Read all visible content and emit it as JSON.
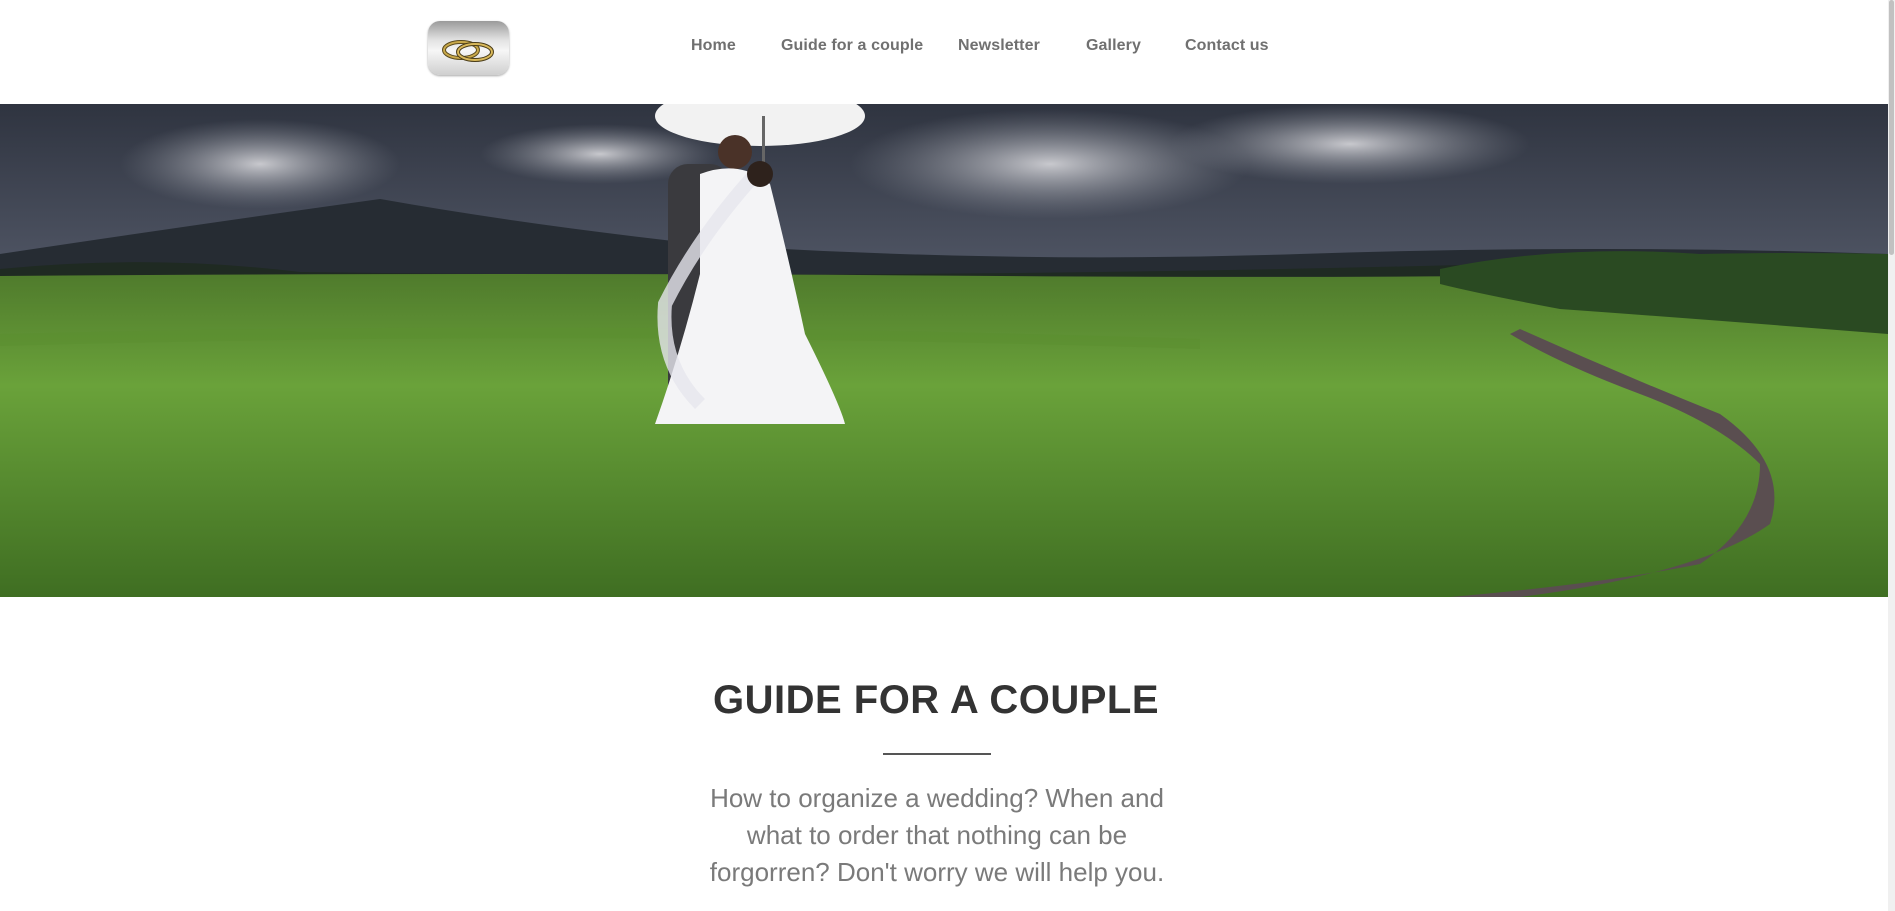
{
  "header": {
    "logo_alt": "Wedding rings logo",
    "nav": [
      {
        "label": "Home"
      },
      {
        "label": "Guide for a couple"
      },
      {
        "label": "Newsletter"
      },
      {
        "label": "Gallery"
      },
      {
        "label": "Contact us"
      }
    ]
  },
  "hero": {
    "image_alt": "Bride and groom under a white umbrella in a green field"
  },
  "section": {
    "title": "GUIDE FOR A COUPLE",
    "lead": "How to organize a wedding? When and what to order that nothing can be forgorren? Don't worry we will help you."
  },
  "colors": {
    "nav_text": "#707070",
    "title_text": "#333333",
    "lead_text": "#7a7a7a",
    "divider": "#555555"
  }
}
